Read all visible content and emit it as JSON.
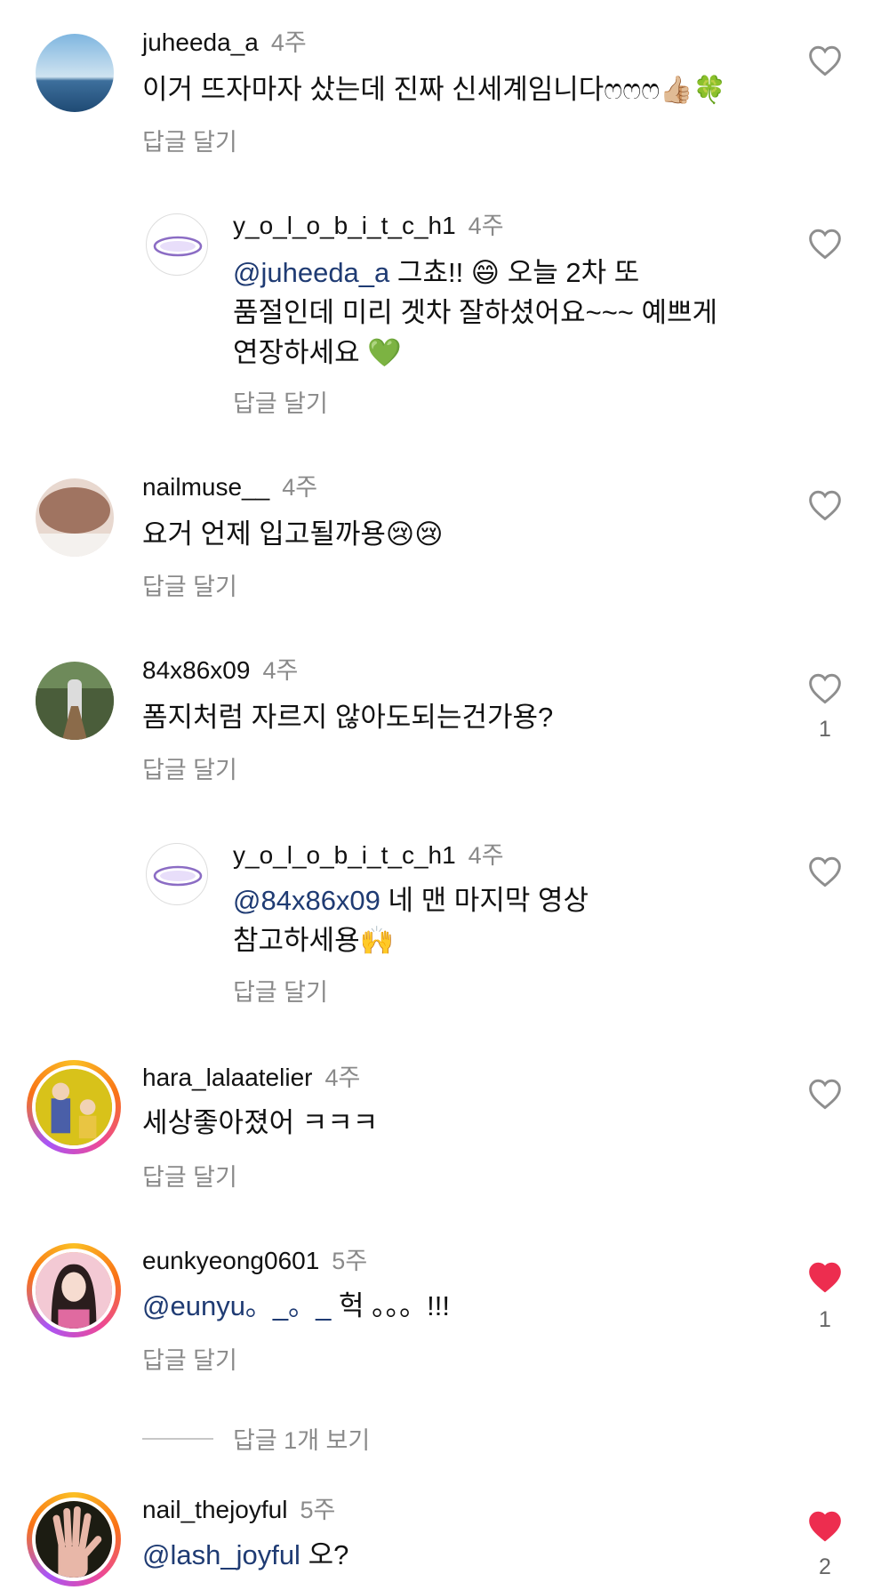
{
  "comments": [
    {
      "username": "juheeda_a",
      "time": "4주",
      "text": "이거 뜨자마자 샀는데 진짜 신세계임니다ෆෆෆ",
      "emoji": "👍🏼🍀",
      "reply_label": "답글 달기",
      "liked": false,
      "likes": ""
    },
    {
      "username": "y_o_l_o_b_i_t_c_h1",
      "time": "4주",
      "mention": "@juheeda_a",
      "text_line1": "그쵸!! 😄 오늘 2차 또",
      "text_line2": "품절인데 미리 겟차 잘하셨어요~~~ 예쁘게",
      "text_line3": "연장하세요 💚",
      "reply_label": "답글 달기",
      "liked": false,
      "likes": ""
    },
    {
      "username": "nailmuse__",
      "time": "4주",
      "text": "요거 언제 입고될까용😢😢",
      "reply_label": "답글 달기",
      "liked": false,
      "likes": ""
    },
    {
      "username": "84x86x09",
      "time": "4주",
      "text": "폼지처럼 자르지 않아도되는건가용?",
      "reply_label": "답글 달기",
      "liked": false,
      "likes": "1"
    },
    {
      "username": "y_o_l_o_b_i_t_c_h1",
      "time": "4주",
      "mention": "@84x86x09",
      "text_line1": "네 맨 마지막 영상",
      "text_line2": "참고하세용🙌",
      "reply_label": "답글 달기",
      "liked": false,
      "likes": ""
    },
    {
      "username": "hara_lalaatelier",
      "time": "4주",
      "text": "세상좋아졌어 ㅋㅋㅋ",
      "reply_label": "답글 달기",
      "liked": false,
      "likes": ""
    },
    {
      "username": "eunkyeong0601",
      "time": "5주",
      "mention": "@eunyu。_。_",
      "text": "헉 。。。!!!",
      "reply_label": "답글 달기",
      "liked": true,
      "likes": "1"
    },
    {
      "username": "nail_thejoyful",
      "time": "5주",
      "mention": "@lash_joyful",
      "text": "오?",
      "liked": true,
      "likes": "2"
    }
  ],
  "view_replies": "답글 1개 보기",
  "colors": {
    "heart_liked": "#ed2d4f",
    "heart_outline": "#8e8e8e",
    "mention": "#1f3b73",
    "secondary_text": "#8a8a8a"
  }
}
